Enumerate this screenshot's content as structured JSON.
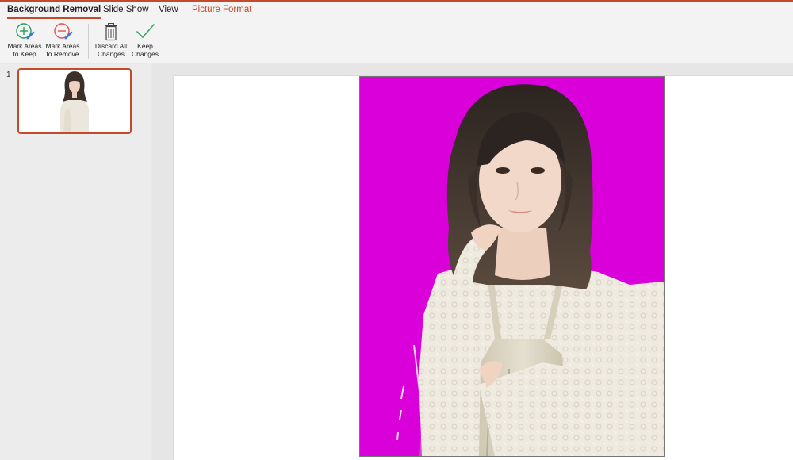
{
  "tabs": [
    {
      "label": "Background Removal",
      "active": true
    },
    {
      "label": "Slide Show"
    },
    {
      "label": "View"
    },
    {
      "label": "Picture Format",
      "contextual": true
    }
  ],
  "ribbon": {
    "mark_keep": {
      "line1": "Mark Areas",
      "line2": "to Keep"
    },
    "mark_remove": {
      "line1": "Mark Areas",
      "line2": "to Remove"
    },
    "discard": {
      "line1": "Discard All",
      "line2": "Changes"
    },
    "keep": {
      "line1": "Keep",
      "line2": "Changes"
    }
  },
  "slides": [
    {
      "number": "1"
    }
  ],
  "colors": {
    "accent": "#c44a2e",
    "removal_overlay": "#d900d9",
    "keep_icon": "#2a9d5c",
    "remove_icon": "#d9534f",
    "check": "#3aa65a"
  }
}
